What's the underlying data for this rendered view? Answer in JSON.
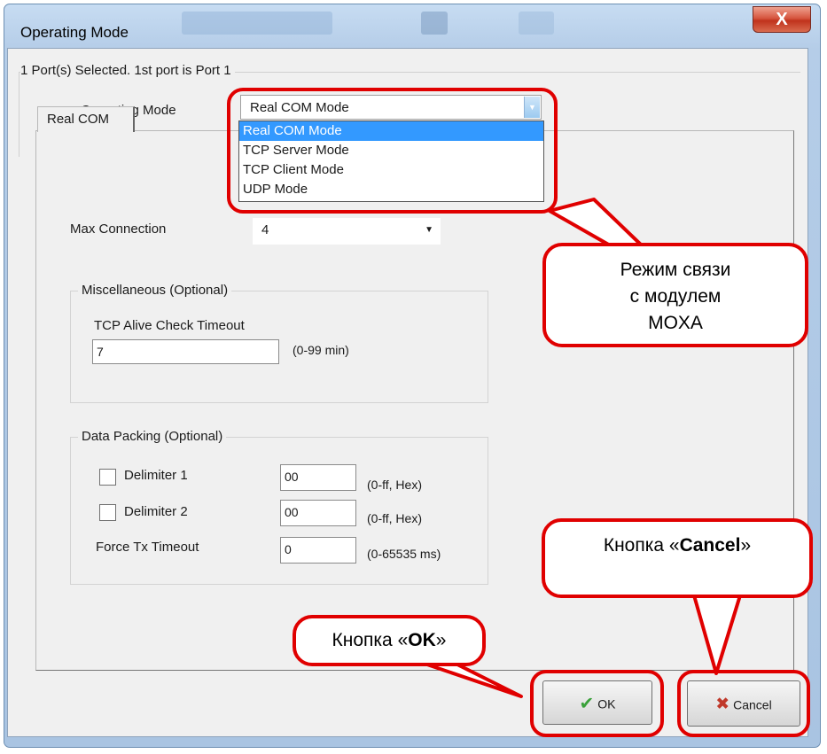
{
  "window": {
    "title": "Operating Mode",
    "close_glyph": "X"
  },
  "header": {
    "ports_selected": "1 Port(s) Selected. 1st port is Port 1"
  },
  "mode": {
    "label": "Operating Mode",
    "selected": "Real COM Mode",
    "options": [
      "Real COM Mode",
      "TCP Server Mode",
      "TCP Client Mode",
      "UDP Mode"
    ]
  },
  "tab": {
    "label": "Real COM"
  },
  "max_connection": {
    "label": "Max Connection",
    "value": "4"
  },
  "misc": {
    "legend": "Miscellaneous (Optional)",
    "alive_label": "TCP Alive Check Timeout",
    "alive_value": "7",
    "alive_range": "(0-99 min)"
  },
  "packing": {
    "legend": "Data Packing (Optional)",
    "delim1_label": "Delimiter 1",
    "delim1_value": "00",
    "delim1_range": "(0-ff, Hex)",
    "delim2_label": "Delimiter 2",
    "delim2_value": "00",
    "delim2_range": "(0-ff, Hex)",
    "force_label": "Force Tx Timeout",
    "force_value": "0",
    "force_range": "(0-65535 ms)"
  },
  "buttons": {
    "ok": "OK",
    "cancel": "Cancel"
  },
  "callouts": {
    "mode_line1": "Режим связи",
    "mode_line2": "с модулем",
    "mode_line3": "MOXA",
    "ok_prefix": "Кнопка «",
    "ok_bold": "OK",
    "ok_suffix": "»",
    "cancel_prefix": "Кнопка «",
    "cancel_bold": "Cancel",
    "cancel_suffix": "»"
  },
  "colors": {
    "highlight": "#e00000",
    "selection": "#3399ff",
    "ok_check": "#3aa13a",
    "cancel_x": "#c0392b"
  }
}
